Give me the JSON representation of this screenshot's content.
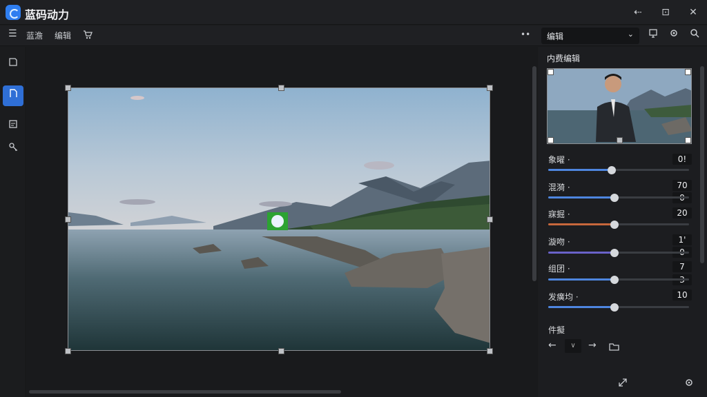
{
  "app": {
    "title": "蓝码动力"
  },
  "window_controls": {
    "a": "⇠",
    "b": "⊡",
    "c": "✕"
  },
  "toolbar": {
    "menu_label": "",
    "items": [
      "蓝澹",
      "编辑"
    ],
    "more": "••"
  },
  "panel": {
    "mode_dropdown": "编辑",
    "section_title": "内费编辑",
    "sliders": [
      {
        "label": "象曜 ·",
        "value": "0!",
        "value2": "",
        "fraction": 0.45,
        "color": "#4e86e0"
      },
      {
        "label": "混漪 ·",
        "value": "70",
        "value2": "0",
        "fraction": 0.47,
        "color": "#4e86e0"
      },
      {
        "label": "寐掘 ·",
        "value": "20",
        "value2": "",
        "fraction": 0.47,
        "color": "#c7673c"
      },
      {
        "label": "漩吻 ·",
        "value": "1'",
        "value2": "0",
        "fraction": 0.47,
        "color": "#6a62c9"
      },
      {
        "label": "组团 ·",
        "value": "7",
        "value2": "3",
        "fraction": 0.47,
        "color": "#4e86e0"
      },
      {
        "label": "发癀均 ·",
        "value": "10",
        "value2": "",
        "fraction": 0.47,
        "color": "#4e86e0"
      }
    ],
    "history_title": "件擬",
    "history_dropdown": "∨"
  },
  "colors": {
    "accent": "#2f7ef0",
    "nav_active": "#2f6fd6"
  },
  "icons": [
    "logo-icon",
    "menu-icon",
    "cart-icon",
    "pin-icon",
    "settings-icon",
    "search-icon",
    "crop-icon",
    "transform-icon",
    "document-icon",
    "adjust-icon",
    "arrow-left-icon",
    "arrow-right-icon",
    "folder-icon",
    "export-icon",
    "gear-icon"
  ]
}
